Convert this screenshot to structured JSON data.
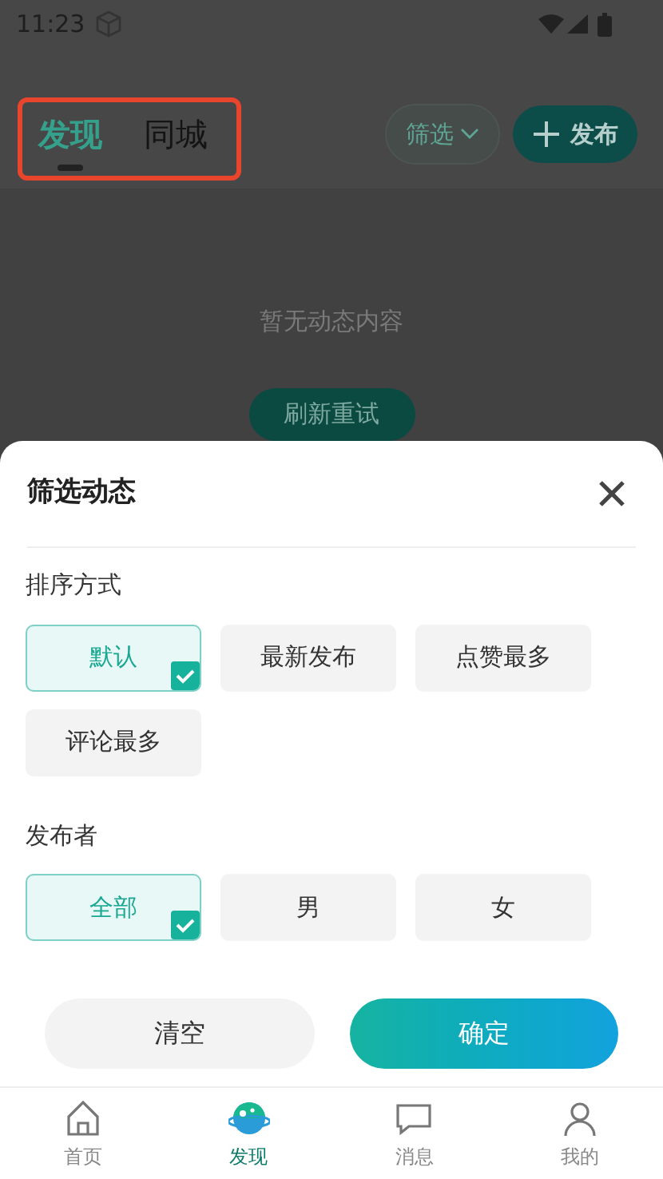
{
  "status_bar": {
    "time": "11:23"
  },
  "header": {
    "tabs": [
      {
        "label": "发现",
        "selected": true
      },
      {
        "label": "同城",
        "selected": false
      }
    ],
    "filter_button": "筛选",
    "publish_button": "发布"
  },
  "empty_state": {
    "message": "暂无动态内容",
    "retry_button": "刷新重试"
  },
  "filter_sheet": {
    "title": "筛选动态",
    "sections": [
      {
        "label": "排序方式",
        "options": [
          {
            "label": "默认",
            "selected": true
          },
          {
            "label": "最新发布",
            "selected": false
          },
          {
            "label": "点赞最多",
            "selected": false
          },
          {
            "label": "评论最多",
            "selected": false
          }
        ]
      },
      {
        "label": "发布者",
        "options": [
          {
            "label": "全部",
            "selected": true
          },
          {
            "label": "男",
            "selected": false
          },
          {
            "label": "女",
            "selected": false
          }
        ]
      }
    ],
    "clear_button": "清空",
    "confirm_button": "确定"
  },
  "bottom_nav": [
    {
      "label": "首页",
      "kind": "home",
      "selected": false
    },
    {
      "label": "发现",
      "kind": "discover",
      "selected": true
    },
    {
      "label": "消息",
      "kind": "messages",
      "selected": false
    },
    {
      "label": "我的",
      "kind": "profile",
      "selected": false
    }
  ]
}
